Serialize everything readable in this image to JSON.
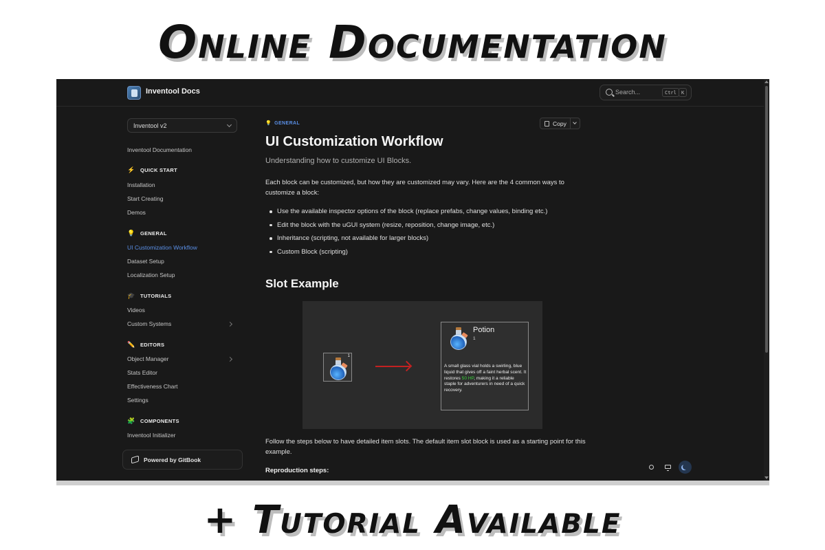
{
  "banner": {
    "top": "Online Documentation",
    "bottom": "+ Tutorial Available"
  },
  "topbar": {
    "site_title": "Inventool Docs",
    "search_placeholder": "Search...",
    "shortcut_ctrl": "Ctrl",
    "shortcut_key": "K"
  },
  "sidebar": {
    "version": "Inventool v2",
    "root_link": "Inventool Documentation",
    "sections": {
      "quick_start": {
        "icon": "⚡",
        "title": "QUICK START",
        "items": [
          "Installation",
          "Start Creating",
          "Demos"
        ]
      },
      "general": {
        "icon": "💡",
        "title": "GENERAL",
        "items": [
          "UI Customization Workflow",
          "Dataset Setup",
          "Localization Setup"
        ]
      },
      "tutorials": {
        "icon": "🎓",
        "title": "TUTORIALS",
        "items": [
          "Videos",
          "Custom Systems"
        ]
      },
      "editors": {
        "icon": "✏️",
        "title": "EDITORS",
        "items": [
          "Object Manager",
          "Stats Editor",
          "Effectiveness Chart",
          "Settings"
        ]
      },
      "components": {
        "icon": "🧩",
        "title": "COMPONENTS",
        "items": [
          "Inventool Initializer"
        ]
      }
    },
    "powered_by": "Powered by GitBook"
  },
  "main": {
    "breadcrumb_icon": "💡",
    "breadcrumb": "GENERAL",
    "copy_label": "Copy",
    "title": "UI Customization Workflow",
    "subtitle": "Understanding how to customize UI Blocks.",
    "intro": "Each block can be customized, but how they are customized may vary. Here are the 4 common ways to customize a block:",
    "bullets": [
      "Use the available inspector options of the block (replace prefabs, change values, binding etc.)",
      "Edit the block with the uGUI system (resize, reposition, change image, etc.)",
      "Inheritance (scripting, not available for larger blocks)",
      "Custom Block (scripting)"
    ],
    "section_heading": "Slot Example",
    "example": {
      "slot_count": "1",
      "item_name": "Potion",
      "item_count": "1",
      "desc_before": "A small glass vial holds a swirling, blue liquid that gives off a faint herbal scent. It restores ",
      "desc_highlight": "50 HP",
      "desc_after": ", making it a reliable staple for adventurers in need of a quick recovery.",
      "highlight_color": "#39d13b",
      "arrow_color": "#c42121"
    },
    "follow_text": "Follow the steps below to have detailed item slots. The default item slot block is used as a starting point for this example.",
    "repro_heading": "Reproduction steps:"
  },
  "colors": {
    "background": "#191919",
    "accent": "#5a8fe6"
  },
  "icons": {
    "search": "search-icon",
    "copy": "copy-icon",
    "gitbook": "gitbook-icon",
    "theme_light": "sun-icon",
    "theme_system": "monitor-icon",
    "theme_dark": "moon-icon"
  }
}
